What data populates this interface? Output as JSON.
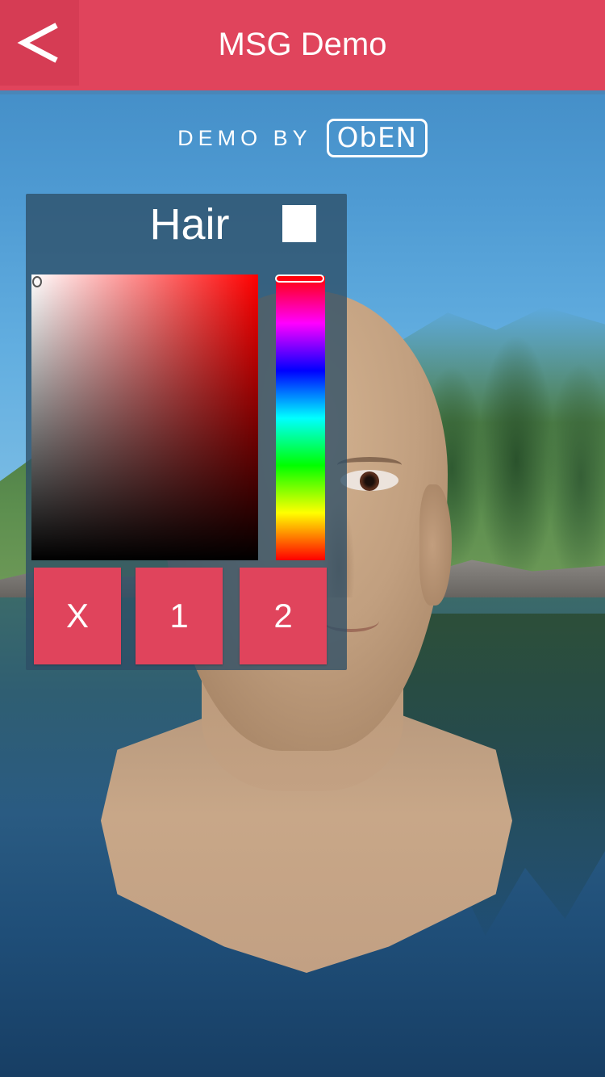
{
  "header": {
    "title": "MSG Demo",
    "back_icon": "chevron-left-icon",
    "background_color": "#e0445c"
  },
  "brand": {
    "prefix": "DEMO BY",
    "logo_text": "ObEN"
  },
  "color_picker": {
    "target_label": "Hair",
    "selected_color": "#ffffff",
    "hue_color": "#ff0000",
    "buttons": {
      "close_label": "X",
      "preset_1_label": "1",
      "preset_2_label": "2"
    }
  },
  "colors": {
    "accent": "#e0445c",
    "panel": "#2d4e66"
  }
}
